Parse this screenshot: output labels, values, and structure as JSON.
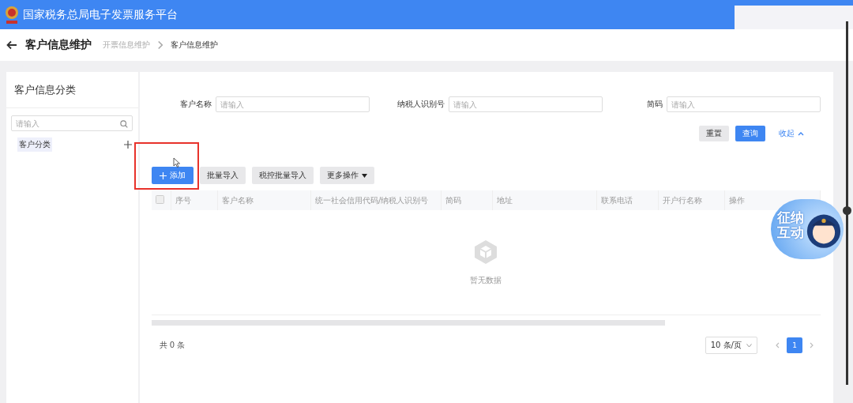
{
  "topbar": {
    "title": "国家税务总局电子发票服务平台"
  },
  "header": {
    "title": "客户信息维护",
    "breadcrumb": [
      "开票信息维护",
      "客户信息维护"
    ]
  },
  "sidebar": {
    "title": "客户信息分类",
    "search": {
      "placeholder": "请输入"
    },
    "items": [
      {
        "label": "客户分类",
        "selected": true
      }
    ]
  },
  "filters": [
    {
      "label": "客户名称",
      "placeholder": "请输入"
    },
    {
      "label": "纳税人识别号",
      "placeholder": "请输入"
    },
    {
      "label": "简码",
      "placeholder": "请输入"
    }
  ],
  "filter_actions": [
    {
      "label": "重置",
      "kind": "plain"
    },
    {
      "label": "查询",
      "kind": "primary"
    },
    {
      "label": "收起",
      "kind": "link"
    }
  ],
  "toolbar": [
    {
      "label": "添加",
      "kind": "primary",
      "highlighted": true
    },
    {
      "label": "批量导入",
      "kind": "plain",
      "highlighted": false
    },
    {
      "label": "税控批量导入",
      "kind": "plain",
      "highlighted": false
    },
    {
      "label": "更多操作",
      "kind": "dropdown",
      "highlighted": false
    }
  ],
  "table": {
    "select_all_checked": false,
    "columns": [
      "序号",
      "客户名称",
      "统一社会信用代码/纳税人识别号",
      "简码",
      "地址",
      "联系电话",
      "开户行名称",
      "操作"
    ],
    "empty_text": "暂无数据"
  },
  "footer": {
    "total": "共 0 条",
    "page_size": "10 条/页",
    "pages": [
      {
        "label": "1",
        "selected": true
      }
    ]
  },
  "assistant": {
    "label": "征纳互动"
  }
}
